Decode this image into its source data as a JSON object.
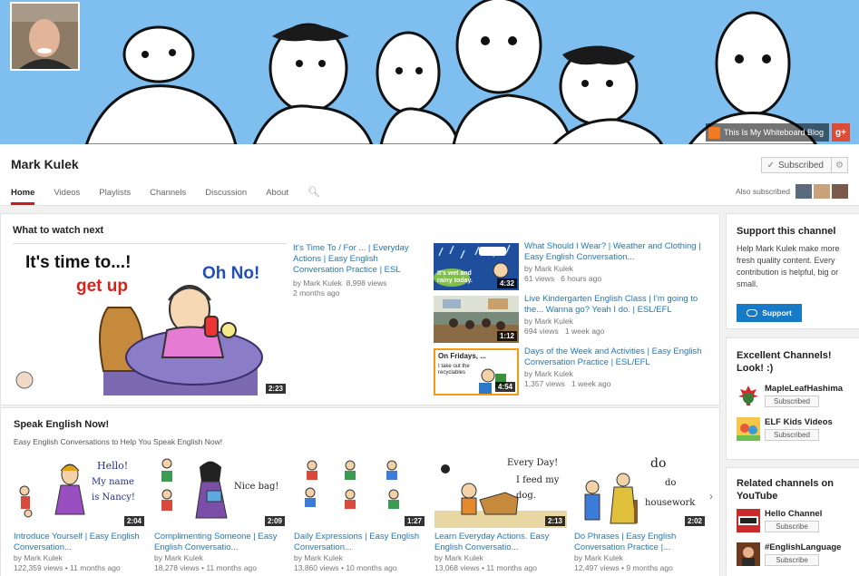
{
  "banner": {
    "blog_link": "This Is My Whiteboard Blog",
    "gplus": "g+"
  },
  "channel": {
    "name": "Mark Kulek",
    "subscribed_label": "Subscribed",
    "also_subscribed": "Also subscribed"
  },
  "tabs": [
    "Home",
    "Videos",
    "Playlists",
    "Channels",
    "Discussion",
    "About"
  ],
  "what_to_watch": {
    "title": "What to watch next",
    "featured": {
      "thumb_text_1": "It's time to...!",
      "thumb_text_2": "get up",
      "thumb_text_3": "Oh No!",
      "duration": "2:23",
      "title": "It's Time To / For ... | Everyday Actions | Easy English Conversation Practice | ESL",
      "channel": "by Mark Kulek",
      "views": "8,998 views",
      "age": "2 months ago"
    },
    "list": [
      {
        "title": "What Should I Wear? | Weather and Clothing | Easy English Conversation...",
        "channel": "by Mark Kulek",
        "views": "61 views",
        "age": "6 hours ago",
        "duration": "4:32",
        "thumb_text": "It's wet and rainy today."
      },
      {
        "title": "Live Kindergarten English Class | I'm going to the... Wanna go? Yeah I do. | ESL/EFL",
        "channel": "by Mark Kulek",
        "views": "694 views",
        "age": "1 week ago",
        "duration": "1:12",
        "thumb_text": ""
      },
      {
        "title": "Days of the Week and Activities | Easy English Conversation Practice | ESL/EFL",
        "channel": "by Mark Kulek",
        "views": "1,357 views",
        "age": "1 week ago",
        "duration": "4:54",
        "thumb_text": "On Fridays, ...",
        "thumb_text_2": "I take out the recyclables"
      }
    ]
  },
  "speak_english": {
    "title": "Speak English Now!",
    "subtitle": "Easy English Conversations to Help You Speak English Now!",
    "videos": [
      {
        "title": "Introduce Yourself | Easy English Conversation...",
        "channel": "by Mark Kulek",
        "views": "122,359 views",
        "age": "11 months ago",
        "duration": "2:04",
        "thumb_text_1": "Hello!",
        "thumb_text_2": "My name is Nancy!"
      },
      {
        "title": "Complimenting Someone | Easy English Conversatio...",
        "channel": "by Mark Kulek",
        "views": "18,278 views",
        "age": "11 months ago",
        "duration": "2:09",
        "thumb_text_1": "Nice bag!"
      },
      {
        "title": "Daily Expressions | Easy English Conversation...",
        "channel": "by Mark Kulek",
        "views": "13,860 views",
        "age": "10 months ago",
        "duration": "1:27"
      },
      {
        "title": "Learn Everyday Actions. Easy English Conversatio...",
        "channel": "by Mark Kulek",
        "views": "13,068 views",
        "age": "11 months ago",
        "duration": "2:13",
        "thumb_text_1": "Every Day!",
        "thumb_text_2": "I feed my dog."
      },
      {
        "title": "Do Phrases | Easy English Conversation Practice |...",
        "channel": "by Mark Kulek",
        "views": "12,497 views",
        "age": "9 months ago",
        "duration": "2:02",
        "thumb_text_1": "do",
        "thumb_text_2": "do",
        "thumb_text_3": "housework"
      }
    ]
  },
  "sidebar": {
    "support": {
      "title": "Support this channel",
      "text": "Help Mark Kulek make more fresh quality content. Every contribution is helpful, big or small.",
      "button": "Support"
    },
    "excellent": {
      "title": "Excellent Channels! Look! :)",
      "channels": [
        {
          "name": "MapleLeafHashima",
          "sub": "Subscribed"
        },
        {
          "name": "ELF Kids Videos",
          "sub": "Subscribed"
        }
      ]
    },
    "related": {
      "title": "Related channels on YouTube",
      "channels": [
        {
          "name": "Hello Channel",
          "sub": "Subscribe"
        },
        {
          "name": "#EnglishLanguage",
          "sub": "Subscribe"
        }
      ]
    }
  }
}
